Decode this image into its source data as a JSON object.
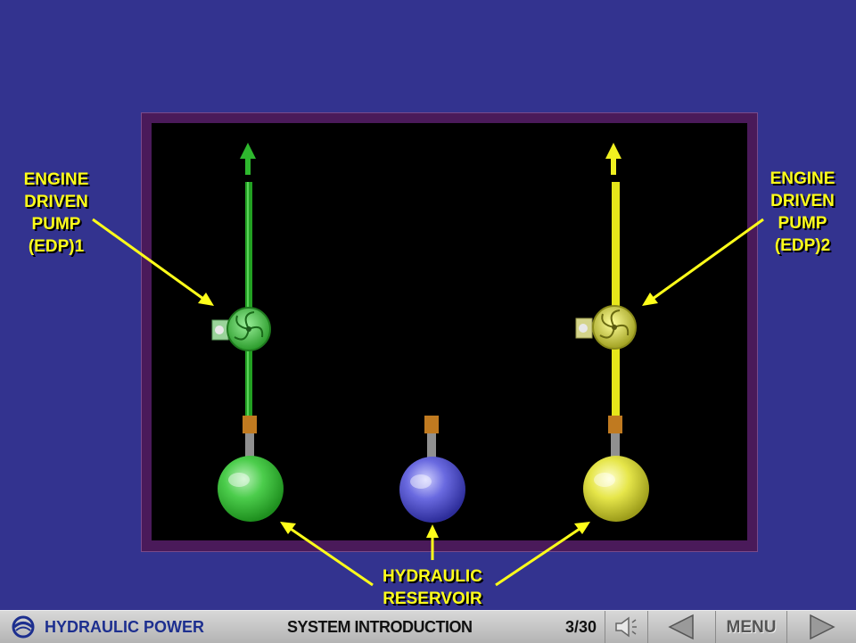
{
  "labels": {
    "edp1": [
      "ENGINE",
      "DRIVEN",
      "PUMP",
      "(EDP)1"
    ],
    "edp2": [
      "ENGINE",
      "DRIVEN",
      "PUMP",
      "(EDP)2"
    ],
    "reservoir": [
      "HYDRAULIC",
      "RESERVOIR"
    ]
  },
  "colors": {
    "green_system": "#2eb82e",
    "yellow_system": "#f0f020",
    "blue_system": "#5a5ad6",
    "label": "#ffff1a",
    "background": "#33338f"
  },
  "footer": {
    "brand": "HYDRAULIC POWER",
    "section": "SYSTEM INTRODUCTION",
    "page": "3/30",
    "menu_label": "MENU",
    "icons": [
      "logo-icon",
      "speaker-icon",
      "previous-arrow-icon",
      "next-arrow-icon"
    ]
  }
}
